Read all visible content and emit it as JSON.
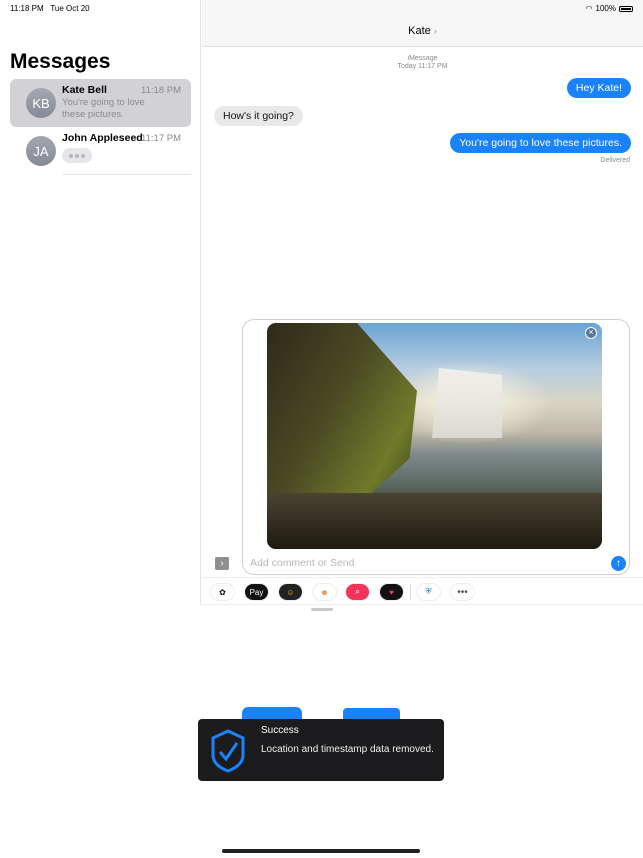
{
  "status_bar": {
    "time": "11:18 PM",
    "date": "Tue Oct 20",
    "battery": "100%"
  },
  "sidebar": {
    "title": "Messages",
    "conversations": [
      {
        "initials": "KB",
        "name": "Kate Bell",
        "time": "11:18 PM",
        "preview": "You're going to love these pictures.",
        "selected": true
      },
      {
        "initials": "JA",
        "name": "John Appleseed",
        "time": "11:17 PM",
        "typing": true
      }
    ]
  },
  "chat": {
    "contact": "Kate",
    "service": "iMessage",
    "timestamp": "Today 11:17 PM",
    "messages": [
      {
        "direction": "outgoing",
        "text": "Hey Kate!"
      },
      {
        "direction": "incoming",
        "text": "How's it going?"
      },
      {
        "direction": "outgoing",
        "text": "You're going to love these pictures."
      }
    ],
    "delivery_status": "Delivered"
  },
  "compose": {
    "placeholder": "Add comment or Send",
    "attachment": "waterfall-photo"
  },
  "app_tray": {
    "apple_pay": "Pay",
    "items": [
      "photos",
      "apple-pay",
      "memoji",
      "memoji-stickers",
      "image-search",
      "digital-touch",
      "privacy-shield-camera",
      "more"
    ]
  },
  "toast": {
    "title": "Success",
    "message": "Location and timestamp data removed."
  },
  "colors": {
    "accent": "#1a82fb",
    "toast_bg": "#1c1c1e"
  }
}
